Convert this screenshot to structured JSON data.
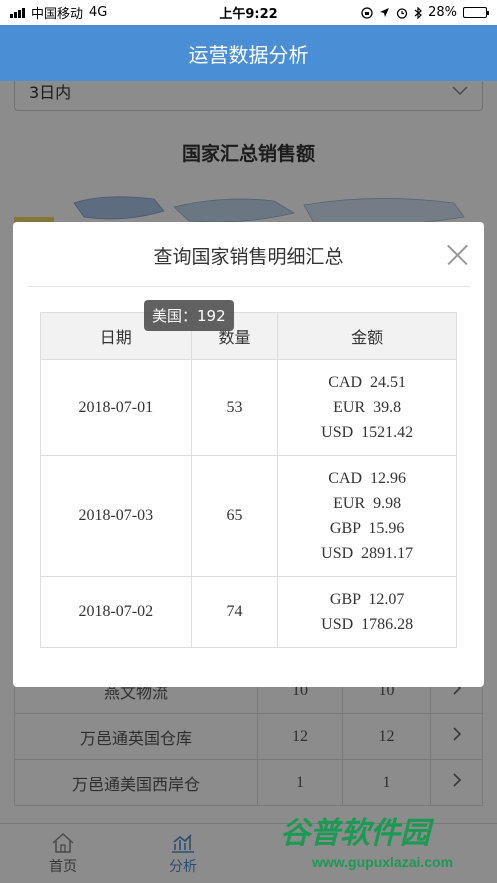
{
  "status_bar": {
    "carrier": "中国移动",
    "network": "4G",
    "time": "上午9:22",
    "battery": "28%",
    "battery_level": 0.28
  },
  "header": {
    "title": "运营数据分析"
  },
  "filter": {
    "selected": "3日内"
  },
  "chart": {
    "title": "国家汇总销售额",
    "tooltip": "美国：192"
  },
  "modal": {
    "title": "查询国家销售明细汇总",
    "columns": [
      "日期",
      "数量",
      "金额"
    ],
    "rows": [
      {
        "date": "2018-07-01",
        "qty": "53",
        "amounts": [
          "CAD  24.51",
          "EUR  39.8",
          "USD  1521.42"
        ]
      },
      {
        "date": "2018-07-03",
        "qty": "65",
        "amounts": [
          "CAD  12.96",
          "EUR  9.98",
          "GBP  15.96",
          "USD  2891.17"
        ]
      },
      {
        "date": "2018-07-02",
        "qty": "74",
        "amounts": [
          "GBP  12.07",
          "USD  1786.28"
        ]
      }
    ]
  },
  "background_table": {
    "rows": [
      {
        "name": "燕文物流",
        "a": "10",
        "b": "10"
      },
      {
        "name": "万邑通英国仓库",
        "a": "12",
        "b": "12"
      },
      {
        "name": "万邑通美国西岸仓",
        "a": "1",
        "b": "1"
      }
    ]
  },
  "tabbar": {
    "items": [
      {
        "label": "首页"
      },
      {
        "label": "分析"
      }
    ]
  },
  "watermark": {
    "text": "谷普软件园",
    "url": "www.gupuxlazai.com"
  },
  "colors": {
    "primary": "#4a8ed6",
    "watermark": "#1b9a53"
  }
}
